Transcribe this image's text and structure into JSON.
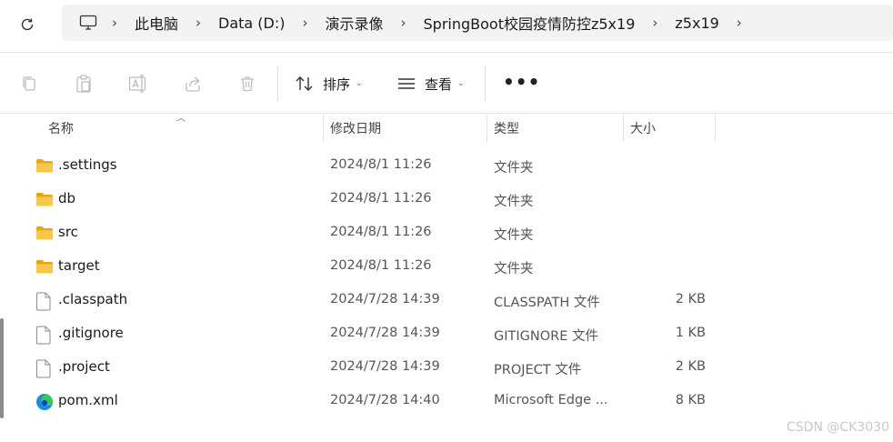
{
  "breadcrumbs": [
    "此电脑",
    "Data (D:)",
    "演示录像",
    "SpringBoot校园疫情防控z5x19",
    "z5x19"
  ],
  "toolbar": {
    "sort_label": "排序",
    "view_label": "查看",
    "more_label": "•••"
  },
  "columns": {
    "name": "名称",
    "modified": "修改日期",
    "type": "类型",
    "size": "大小"
  },
  "files": [
    {
      "name": ".settings",
      "modified": "2024/8/1 11:26",
      "type": "文件夹",
      "size": "",
      "icon": "folder-icon"
    },
    {
      "name": "db",
      "modified": "2024/8/1 11:26",
      "type": "文件夹",
      "size": "",
      "icon": "folder-icon"
    },
    {
      "name": "src",
      "modified": "2024/8/1 11:26",
      "type": "文件夹",
      "size": "",
      "icon": "folder-icon"
    },
    {
      "name": "target",
      "modified": "2024/8/1 11:26",
      "type": "文件夹",
      "size": "",
      "icon": "folder-icon"
    },
    {
      "name": ".classpath",
      "modified": "2024/7/28 14:39",
      "type": "CLASSPATH 文件",
      "size": "2 KB",
      "icon": "file-icon"
    },
    {
      "name": ".gitignore",
      "modified": "2024/7/28 14:39",
      "type": "GITIGNORE 文件",
      "size": "1 KB",
      "icon": "file-icon"
    },
    {
      "name": ".project",
      "modified": "2024/7/28 14:39",
      "type": "PROJECT 文件",
      "size": "2 KB",
      "icon": "file-icon"
    },
    {
      "name": "pom.xml",
      "modified": "2024/7/28 14:40",
      "type": "Microsoft Edge ...",
      "size": "8 KB",
      "icon": "edge-icon"
    }
  ],
  "watermark": "CSDN @CK3030",
  "colors": {
    "folder": "#f4c542",
    "address_bg": "#f3f3f3",
    "accent": "#0067c0"
  }
}
